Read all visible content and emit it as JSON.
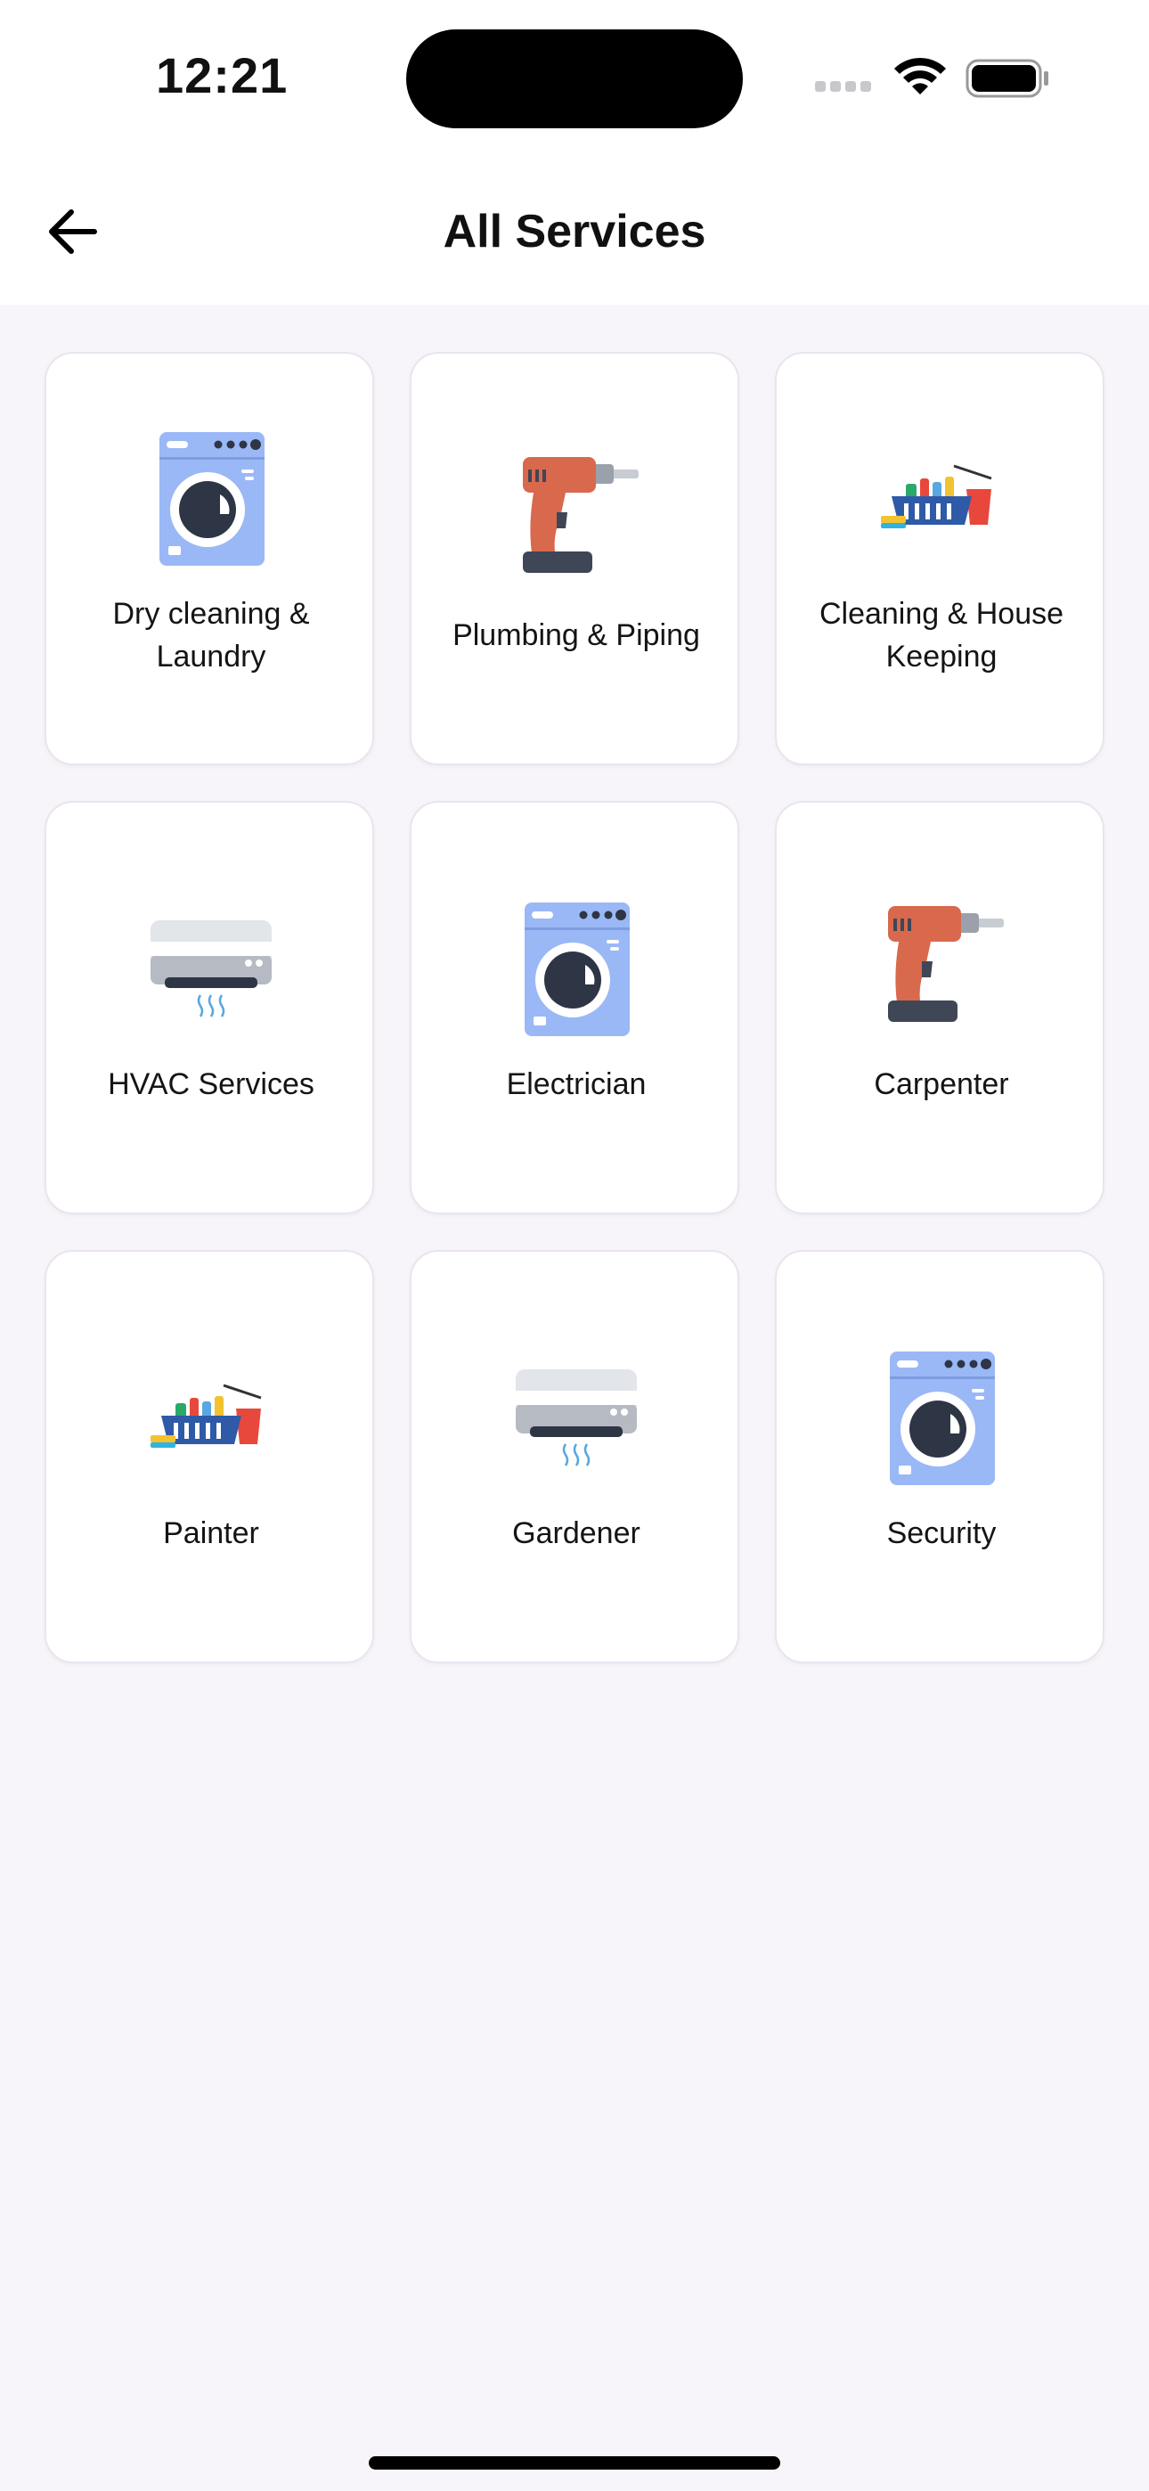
{
  "status": {
    "time": "12:21"
  },
  "header": {
    "title": "All Services"
  },
  "services": [
    {
      "label": "Dry cleaning & Laundry",
      "icon": "washing-machine-icon"
    },
    {
      "label": "Plumbing & Piping",
      "icon": "drill-icon"
    },
    {
      "label": "Cleaning & House Keeping",
      "icon": "cleaning-basket-icon"
    },
    {
      "label": "HVAC Services",
      "icon": "air-conditioner-icon"
    },
    {
      "label": "Electrician",
      "icon": "washing-machine-icon"
    },
    {
      "label": "Carpenter",
      "icon": "drill-icon"
    },
    {
      "label": "Painter",
      "icon": "cleaning-basket-icon"
    },
    {
      "label": "Gardener",
      "icon": "air-conditioner-icon"
    },
    {
      "label": "Security",
      "icon": "washing-machine-icon"
    }
  ],
  "colors": {
    "background": "#f8f5fa",
    "card": "#ffffff",
    "washer_blue": "#9ab8f6",
    "drill_orange": "#d8694d",
    "basket_blue": "#2f5aa8",
    "ac_gray": "#e2e5ea"
  }
}
